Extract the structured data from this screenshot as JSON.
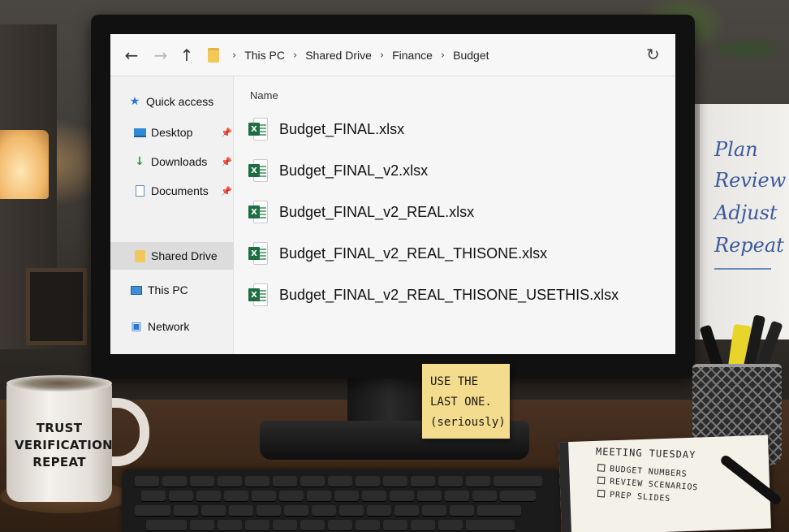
{
  "explorer": {
    "nav": {
      "back_icon": "arrow-left-icon",
      "forward_icon": "arrow-right-icon",
      "up_icon": "arrow-up-icon",
      "refresh_icon": "refresh-icon"
    },
    "breadcrumb": [
      "This PC",
      "Shared Drive",
      "Finance",
      "Budget"
    ],
    "sidebar": [
      {
        "label": "Quick access",
        "icon": "star-icon",
        "pinned": false
      },
      {
        "label": "Desktop",
        "icon": "desktop-icon",
        "pinned": true
      },
      {
        "label": "Downloads",
        "icon": "download-icon",
        "pinned": true
      },
      {
        "label": "Documents",
        "icon": "document-icon",
        "pinned": true
      },
      {
        "label": "Shared Drive",
        "icon": "folder-icon",
        "pinned": false,
        "selected": true
      },
      {
        "label": "This PC",
        "icon": "computer-icon",
        "pinned": false
      },
      {
        "label": "Network",
        "icon": "network-icon",
        "pinned": false
      }
    ],
    "column_header": "Name",
    "files": [
      "Budget_FINAL.xlsx",
      "Budget_FINAL_v2.xlsx",
      "Budget_FINAL_v2_REAL.xlsx",
      "Budget_FINAL_v2_REAL_THISONE.xlsx",
      "Budget_FINAL_v2_REAL_THISONE_USETHIS.xlsx"
    ],
    "excel_icon_color": "#1d6f42"
  },
  "sticky_note": [
    "USE THE",
    "LAST ONE.",
    "(seriously)"
  ],
  "mug": [
    "TRUST",
    "VERIFICATION",
    "REPEAT"
  ],
  "whiteboard": [
    "Plan",
    "Review",
    "Adjust",
    "Repeat"
  ],
  "notebook": {
    "title": "MEETING TUESDAY",
    "items": [
      "BUDGET NUMBERS",
      "REVIEW SCENARIOS",
      "PREP SLIDES"
    ]
  }
}
